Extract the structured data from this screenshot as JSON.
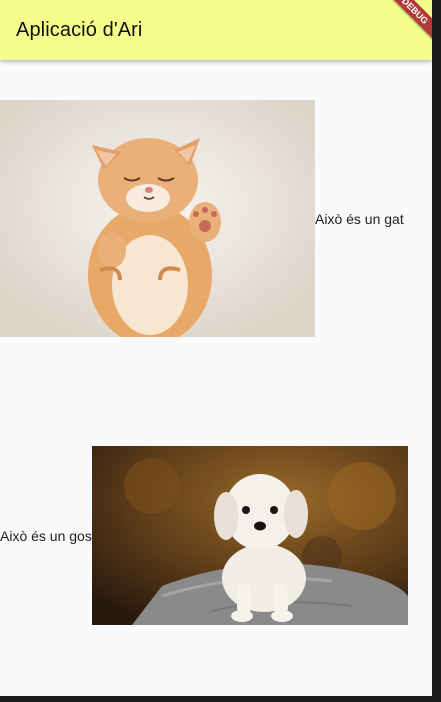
{
  "appbar": {
    "title": "Aplicació d'Ari",
    "debug_banner": "DEBUG"
  },
  "items": [
    {
      "caption": "Això és un gat",
      "image": "kitten-photo"
    },
    {
      "caption": "Això és un gos",
      "image": "puppy-photo"
    }
  ],
  "colors": {
    "appbar": "#f4fc8c",
    "background": "#fafafa",
    "banner": "#b33a3a"
  }
}
